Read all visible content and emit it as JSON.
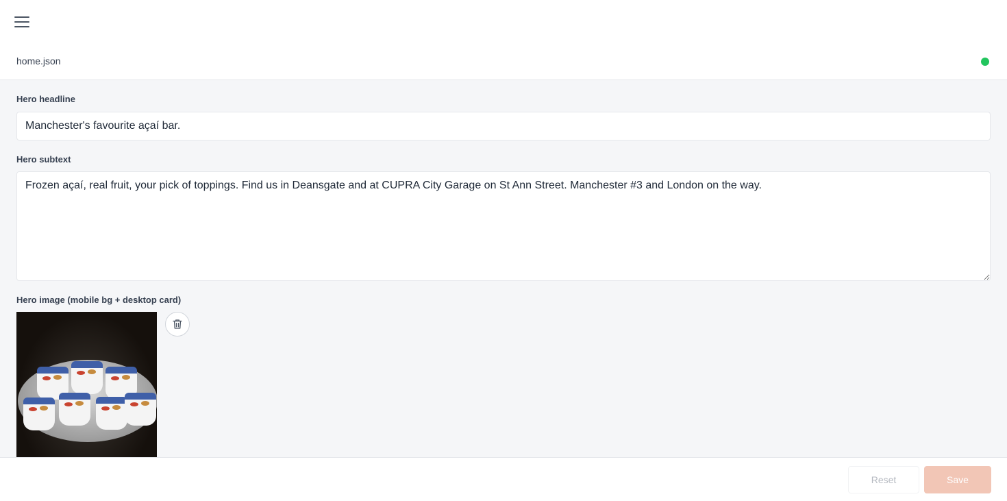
{
  "header": {
    "menu_icon": "hamburger-menu-icon",
    "filename": "home.json",
    "status_color": "#22c55e"
  },
  "form": {
    "hero_headline": {
      "label": "Hero headline",
      "value": "Manchester's favourite açaí bar."
    },
    "hero_subtext": {
      "label": "Hero subtext",
      "value": "Frozen açaí, real fruit, your pick of toppings. Find us in Deansgate and at CUPRA City Garage on St Ann Street. Manchester #3 and London on the way."
    },
    "hero_image": {
      "label": "Hero image (mobile bg + desktop card)",
      "delete_icon": "trash-icon"
    }
  },
  "footer": {
    "reset_label": "Reset",
    "save_label": "Save",
    "accent_color": "#f2c6b6"
  }
}
